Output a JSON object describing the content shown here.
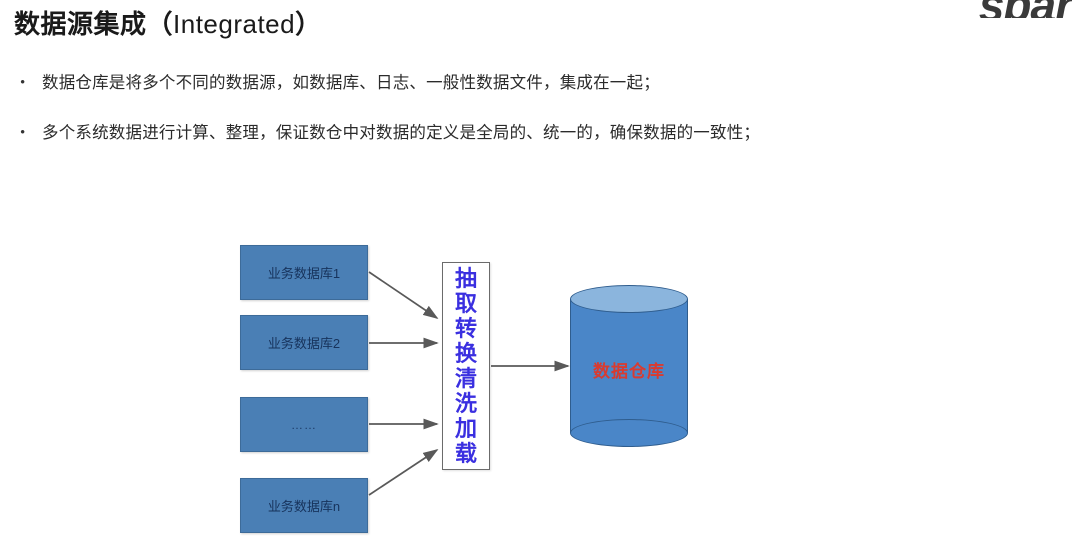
{
  "logo": {
    "text": "spar"
  },
  "title": {
    "cn": "数据源集成（",
    "en": "Integrated",
    "cn_close": "）"
  },
  "bullets": [
    {
      "marker": "•",
      "text": "数据仓库是将多个不同的数据源，如数据库、日志、一般性数据文件，集成在一起；"
    },
    {
      "marker": "•",
      "text": "多个系统数据进行计算、整理，保证数仓中对数据的定义是全局的、统一的，确保数据的一致性；"
    }
  ],
  "diagram": {
    "sources": [
      {
        "label": "业务数据库1"
      },
      {
        "label": "业务数据库2"
      },
      {
        "label": "……"
      },
      {
        "label": "业务数据库n"
      }
    ],
    "etl": {
      "chars": [
        "抽",
        "取",
        "转",
        "换",
        "清",
        "洗",
        "加",
        "载"
      ],
      "full": "抽取转换清洗加载"
    },
    "warehouse": {
      "label": "数据仓库"
    }
  },
  "colors": {
    "source_fill": "#4a7fb5",
    "etl_text": "#3a2fe0",
    "warehouse_fill": "#4a86c8",
    "warehouse_top": "#8bb5dd",
    "warehouse_label": "#d93b30",
    "arrow": "#595959"
  }
}
